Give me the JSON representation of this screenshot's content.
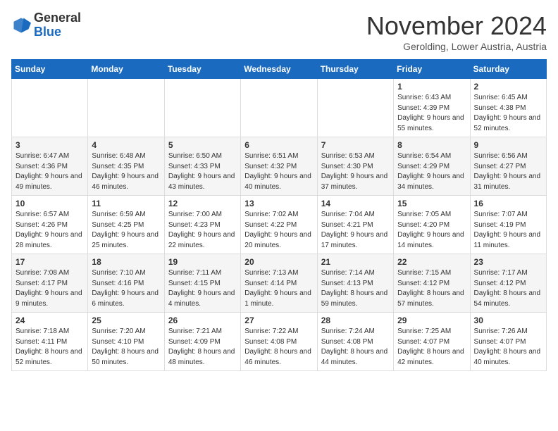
{
  "header": {
    "logo_general": "General",
    "logo_blue": "Blue",
    "month_title": "November 2024",
    "subtitle": "Gerolding, Lower Austria, Austria"
  },
  "days_of_week": [
    "Sunday",
    "Monday",
    "Tuesday",
    "Wednesday",
    "Thursday",
    "Friday",
    "Saturday"
  ],
  "weeks": [
    [
      {
        "day": "",
        "info": ""
      },
      {
        "day": "",
        "info": ""
      },
      {
        "day": "",
        "info": ""
      },
      {
        "day": "",
        "info": ""
      },
      {
        "day": "",
        "info": ""
      },
      {
        "day": "1",
        "info": "Sunrise: 6:43 AM\nSunset: 4:39 PM\nDaylight: 9 hours and 55 minutes."
      },
      {
        "day": "2",
        "info": "Sunrise: 6:45 AM\nSunset: 4:38 PM\nDaylight: 9 hours and 52 minutes."
      }
    ],
    [
      {
        "day": "3",
        "info": "Sunrise: 6:47 AM\nSunset: 4:36 PM\nDaylight: 9 hours and 49 minutes."
      },
      {
        "day": "4",
        "info": "Sunrise: 6:48 AM\nSunset: 4:35 PM\nDaylight: 9 hours and 46 minutes."
      },
      {
        "day": "5",
        "info": "Sunrise: 6:50 AM\nSunset: 4:33 PM\nDaylight: 9 hours and 43 minutes."
      },
      {
        "day": "6",
        "info": "Sunrise: 6:51 AM\nSunset: 4:32 PM\nDaylight: 9 hours and 40 minutes."
      },
      {
        "day": "7",
        "info": "Sunrise: 6:53 AM\nSunset: 4:30 PM\nDaylight: 9 hours and 37 minutes."
      },
      {
        "day": "8",
        "info": "Sunrise: 6:54 AM\nSunset: 4:29 PM\nDaylight: 9 hours and 34 minutes."
      },
      {
        "day": "9",
        "info": "Sunrise: 6:56 AM\nSunset: 4:27 PM\nDaylight: 9 hours and 31 minutes."
      }
    ],
    [
      {
        "day": "10",
        "info": "Sunrise: 6:57 AM\nSunset: 4:26 PM\nDaylight: 9 hours and 28 minutes."
      },
      {
        "day": "11",
        "info": "Sunrise: 6:59 AM\nSunset: 4:25 PM\nDaylight: 9 hours and 25 minutes."
      },
      {
        "day": "12",
        "info": "Sunrise: 7:00 AM\nSunset: 4:23 PM\nDaylight: 9 hours and 22 minutes."
      },
      {
        "day": "13",
        "info": "Sunrise: 7:02 AM\nSunset: 4:22 PM\nDaylight: 9 hours and 20 minutes."
      },
      {
        "day": "14",
        "info": "Sunrise: 7:04 AM\nSunset: 4:21 PM\nDaylight: 9 hours and 17 minutes."
      },
      {
        "day": "15",
        "info": "Sunrise: 7:05 AM\nSunset: 4:20 PM\nDaylight: 9 hours and 14 minutes."
      },
      {
        "day": "16",
        "info": "Sunrise: 7:07 AM\nSunset: 4:19 PM\nDaylight: 9 hours and 11 minutes."
      }
    ],
    [
      {
        "day": "17",
        "info": "Sunrise: 7:08 AM\nSunset: 4:17 PM\nDaylight: 9 hours and 9 minutes."
      },
      {
        "day": "18",
        "info": "Sunrise: 7:10 AM\nSunset: 4:16 PM\nDaylight: 9 hours and 6 minutes."
      },
      {
        "day": "19",
        "info": "Sunrise: 7:11 AM\nSunset: 4:15 PM\nDaylight: 9 hours and 4 minutes."
      },
      {
        "day": "20",
        "info": "Sunrise: 7:13 AM\nSunset: 4:14 PM\nDaylight: 9 hours and 1 minute."
      },
      {
        "day": "21",
        "info": "Sunrise: 7:14 AM\nSunset: 4:13 PM\nDaylight: 8 hours and 59 minutes."
      },
      {
        "day": "22",
        "info": "Sunrise: 7:15 AM\nSunset: 4:12 PM\nDaylight: 8 hours and 57 minutes."
      },
      {
        "day": "23",
        "info": "Sunrise: 7:17 AM\nSunset: 4:12 PM\nDaylight: 8 hours and 54 minutes."
      }
    ],
    [
      {
        "day": "24",
        "info": "Sunrise: 7:18 AM\nSunset: 4:11 PM\nDaylight: 8 hours and 52 minutes."
      },
      {
        "day": "25",
        "info": "Sunrise: 7:20 AM\nSunset: 4:10 PM\nDaylight: 8 hours and 50 minutes."
      },
      {
        "day": "26",
        "info": "Sunrise: 7:21 AM\nSunset: 4:09 PM\nDaylight: 8 hours and 48 minutes."
      },
      {
        "day": "27",
        "info": "Sunrise: 7:22 AM\nSunset: 4:08 PM\nDaylight: 8 hours and 46 minutes."
      },
      {
        "day": "28",
        "info": "Sunrise: 7:24 AM\nSunset: 4:08 PM\nDaylight: 8 hours and 44 minutes."
      },
      {
        "day": "29",
        "info": "Sunrise: 7:25 AM\nSunset: 4:07 PM\nDaylight: 8 hours and 42 minutes."
      },
      {
        "day": "30",
        "info": "Sunrise: 7:26 AM\nSunset: 4:07 PM\nDaylight: 8 hours and 40 minutes."
      }
    ]
  ]
}
